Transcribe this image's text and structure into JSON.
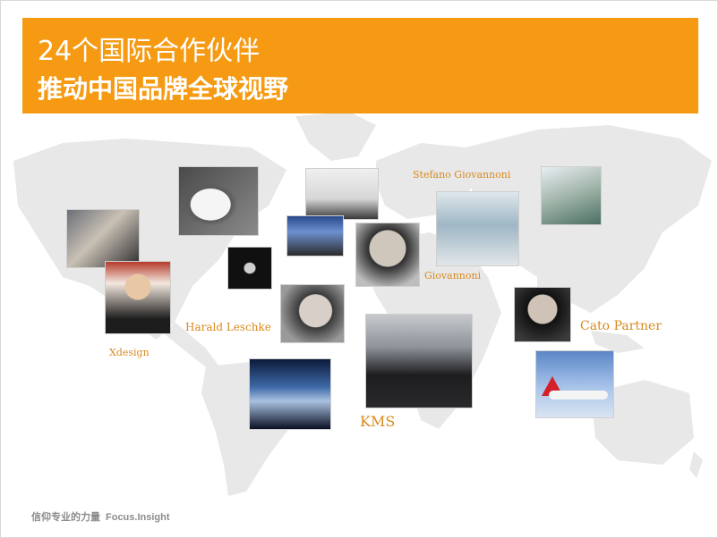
{
  "header": {
    "title_line1": "24个国际合作伙伴",
    "title_line2": "推动中国品牌全球视野"
  },
  "labels": {
    "stefano": "Stefano Giovannoni",
    "giovannoni": "Giovannoni",
    "harald": "Harald Leschke",
    "xdesign": "Xdesign",
    "cato": "Cato Partner",
    "kms": "KMS"
  },
  "footer": {
    "tagline_cn": "信仰专业的力量",
    "tagline_en": "Focus.Insight"
  },
  "colors": {
    "banner": "#f59a12",
    "label": "#d88a1e",
    "map": "#e8e8e8"
  }
}
